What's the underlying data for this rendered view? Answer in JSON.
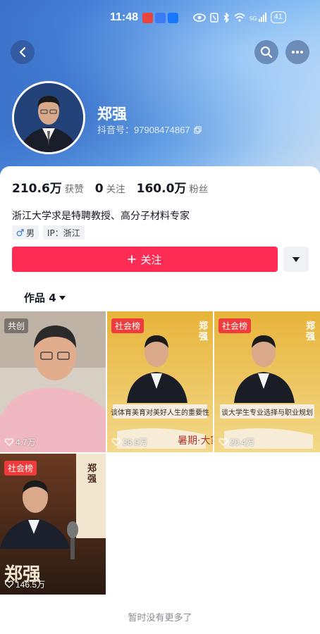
{
  "status_bar": {
    "time": "11:48",
    "network": "5G",
    "battery": "41"
  },
  "profile": {
    "name": "郑强",
    "douyin_id_label": "抖音号：",
    "douyin_id": "97908474867",
    "stats": [
      {
        "value": "210.6万",
        "label": "获赞"
      },
      {
        "value": "0",
        "label": "关注"
      },
      {
        "value": "160.0万",
        "label": "粉丝"
      }
    ],
    "bio": "浙江大学求是特聘教授、高分子材料专家",
    "tags": [
      {
        "icon": "male-icon",
        "label": "男"
      },
      {
        "icon": "",
        "label": "IP：浙江"
      }
    ],
    "follow_label": "关注"
  },
  "works": {
    "tab_label": "作品 4",
    "items": [
      {
        "badge": "共创",
        "likes": "4.7万",
        "type": "photo"
      },
      {
        "badge": "社会榜",
        "likes": "38.9万",
        "type": "poster",
        "caption": "谈体育美育对美好人生的重要性",
        "side_name": "郑强"
      },
      {
        "badge": "社会榜",
        "likes": "20.4万",
        "type": "poster",
        "caption": "谈大学生专业选择与职业规划",
        "side_name": "郑强"
      },
      {
        "badge": "社会榜",
        "likes": "146.5万",
        "type": "poster-dark",
        "side_name": "郑强"
      }
    ],
    "footer": "暂时没有更多了"
  },
  "colors": {
    "accent": "#fe2c55",
    "rank_badge": "#ee3b3b",
    "header_blue": "#4a8be0"
  }
}
